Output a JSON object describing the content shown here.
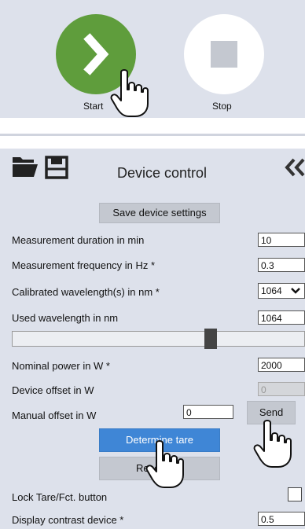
{
  "controls": {
    "start_label": "Start",
    "stop_label": "Stop"
  },
  "device_control": {
    "title": "Device control",
    "save_label": "Save device settings",
    "rows": {
      "duration": {
        "label": "Measurement duration in min",
        "value": "10"
      },
      "frequency": {
        "label": "Measurement frequency in Hz *",
        "value": "0.3"
      },
      "calibrated": {
        "label": "Calibrated wavelength(s) in nm *",
        "value": "1064"
      },
      "used": {
        "label": "Used wavelength in nm",
        "value": "1064"
      },
      "power": {
        "label": "Nominal power in W *",
        "value": "2000"
      },
      "offset": {
        "label": "Device offset in W",
        "value": "0"
      },
      "manual": {
        "label": "Manual offset in W",
        "value": "0"
      },
      "lock": {
        "label": "Lock Tare/Fct. button"
      },
      "contrast": {
        "label": "Display contrast device *",
        "value": "0.5"
      }
    },
    "send_label": "Send",
    "tare_label": "Determine tare",
    "reset_label": "Reset tare"
  },
  "colors": {
    "panel_bg": "#dde1eb",
    "start_green": "#5f9d3c",
    "tare_blue": "#3f86d6",
    "button_gray": "#c4c8d0"
  },
  "icons": [
    "chevron-right-icon",
    "stop-square-icon",
    "folder-icon",
    "save-icon",
    "double-chevron-left-icon",
    "hand-pointer-icon",
    "chevron-down-icon"
  ]
}
